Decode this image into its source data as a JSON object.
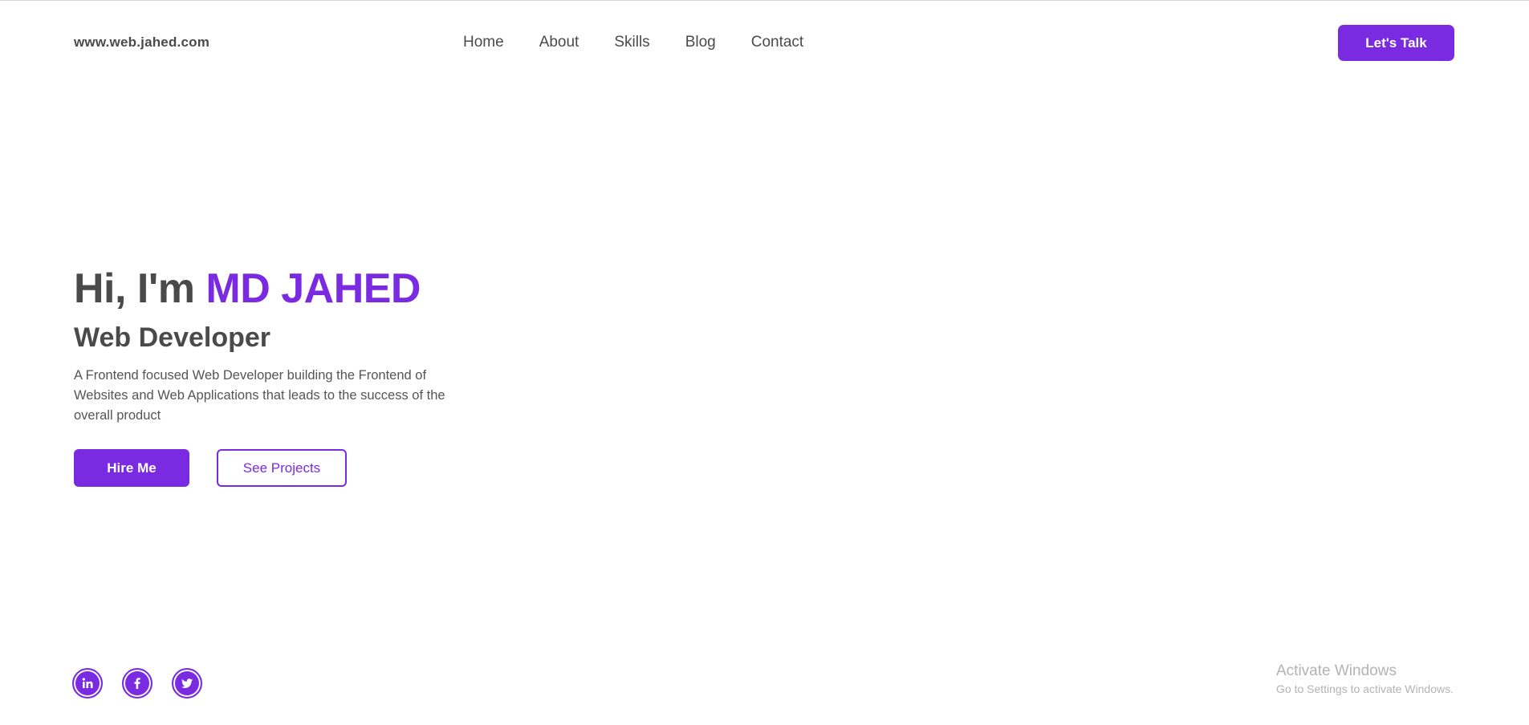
{
  "header": {
    "site_url": "www.web.jahed.com",
    "nav": [
      "Home",
      "About",
      "Skills",
      "Blog",
      "Contact"
    ],
    "cta": "Let's Talk"
  },
  "hero": {
    "greeting": "Hi, I'm",
    "name": "MD JAHED",
    "role": "Web Developer",
    "description": "A Frontend focused Web Developer building the Frontend of Websites and Web Applications that leads to the success of the overall product",
    "hire_button": "Hire Me",
    "projects_button": "See Projects"
  },
  "socials": [
    {
      "icon": "linkedin-icon"
    },
    {
      "icon": "facebook-icon"
    },
    {
      "icon": "twitter-icon"
    }
  ],
  "watermark": {
    "title": "Activate Windows",
    "subtitle": "Go to Settings to activate Windows."
  },
  "colors": {
    "accent": "#7a2be2",
    "text": "#4a4a4a"
  }
}
